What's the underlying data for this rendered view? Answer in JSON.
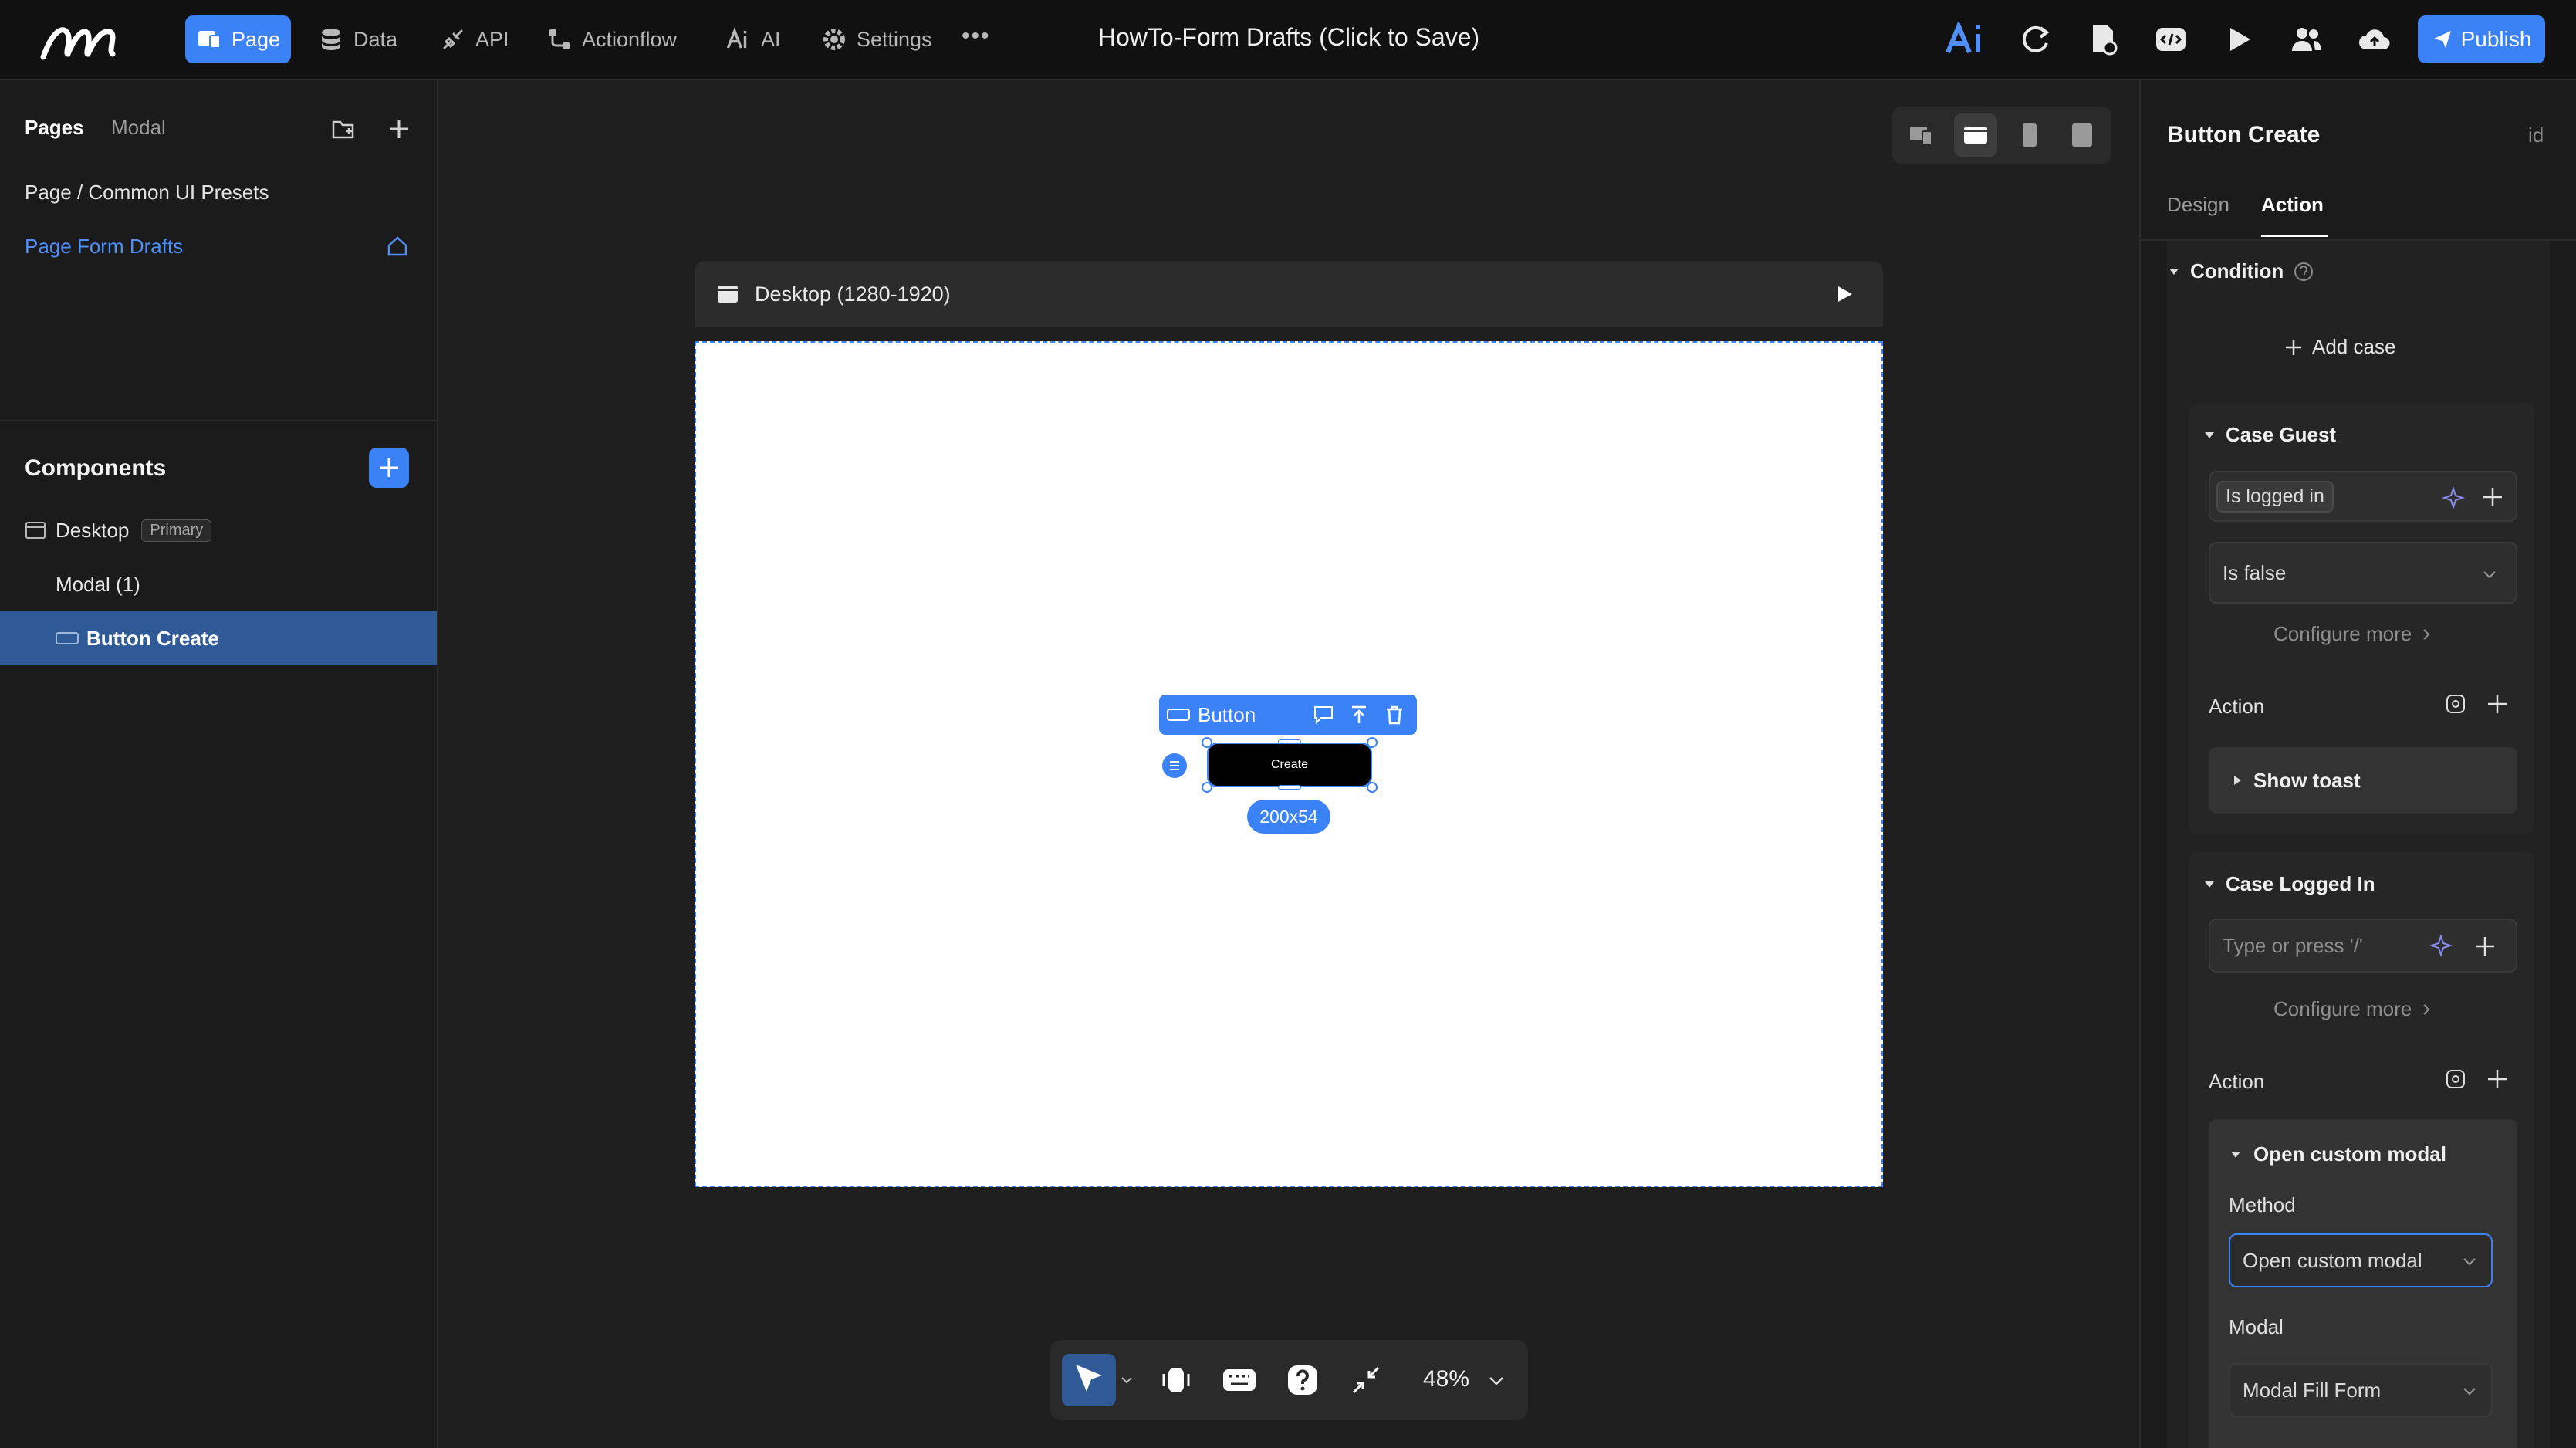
{
  "nav": {
    "items": [
      {
        "label": "Page",
        "icon": "page-icon",
        "active": true
      },
      {
        "label": "Data",
        "icon": "database-icon"
      },
      {
        "label": "API",
        "icon": "api-icon"
      },
      {
        "label": "Actionflow",
        "icon": "actionflow-icon"
      },
      {
        "label": "AI",
        "icon": "ai-icon"
      },
      {
        "label": "Settings",
        "icon": "gear-icon"
      }
    ],
    "title": "HowTo-Form Drafts (Click to Save)",
    "publish_label": "Publish"
  },
  "left": {
    "tabs": [
      "Pages",
      "Modal"
    ],
    "pages": [
      "Page / Common UI Presets",
      "Page Form Drafts"
    ],
    "components_title": "Components",
    "tree": [
      {
        "label": "Desktop",
        "badge": "Primary"
      },
      {
        "label": "Modal (1)"
      },
      {
        "label": "Button Create",
        "selected": true
      }
    ]
  },
  "canvas": {
    "frame_label": "Desktop (1280-1920)",
    "selection_label": "Button",
    "button_text": "Create",
    "size_label": "200x54",
    "zoom": "48%"
  },
  "right": {
    "title": "Button Create",
    "id_label": "id",
    "tabs": [
      "Design",
      "Action"
    ],
    "condition_label": "Condition",
    "add_case": "Add case",
    "case_guest": {
      "title": "Case Guest",
      "chip": "Is logged in",
      "select": "Is false",
      "configure": "Configure more",
      "action_label": "Action",
      "action_item": "Show toast"
    },
    "case_logged": {
      "title": "Case Logged In",
      "placeholder": "Type or press '/'",
      "configure": "Configure more",
      "action_label": "Action",
      "action_item": "Open custom modal",
      "method_label": "Method",
      "method_value": "Open custom modal",
      "modal_label": "Modal",
      "modal_value": "Modal Fill Form"
    }
  },
  "colors": {
    "accent": "#3b82f6",
    "bg": "#1f1f1f",
    "panel": "#1b1b1b"
  }
}
